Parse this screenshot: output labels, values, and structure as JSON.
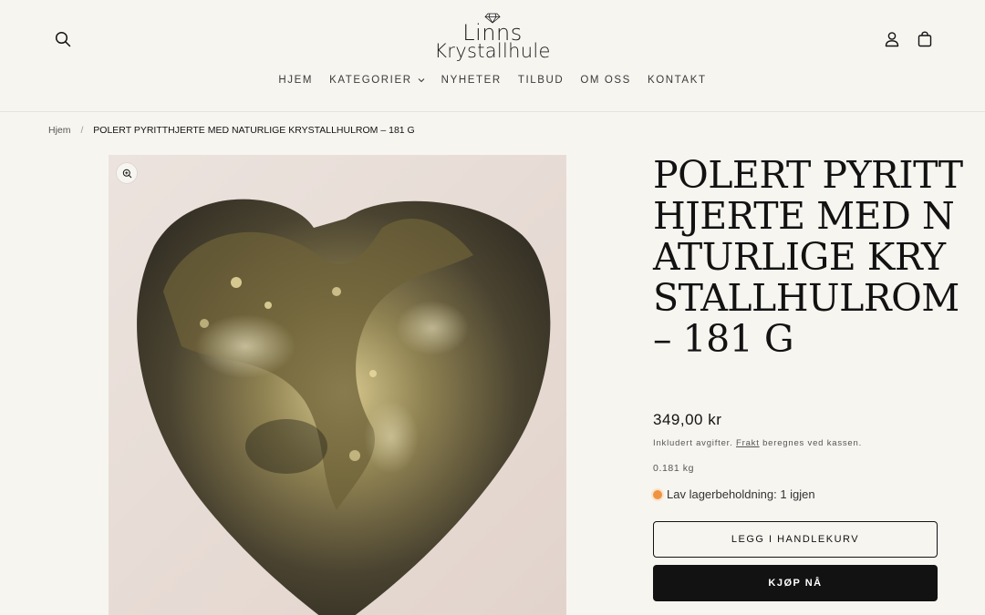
{
  "header": {
    "logo_line1": "Linns",
    "logo_line2": "Krystallhule",
    "search_icon": "search-icon",
    "account_icon": "account-icon",
    "cart_icon": "shopping-bag-icon"
  },
  "nav": {
    "items": [
      {
        "label": "HJEM"
      },
      {
        "label": "KATEGORIER",
        "has_dropdown": true
      },
      {
        "label": "NYHETER"
      },
      {
        "label": "TILBUD"
      },
      {
        "label": "OM OSS"
      },
      {
        "label": "KONTAKT"
      }
    ]
  },
  "breadcrumb": {
    "home": "Hjem",
    "separator": "/",
    "current": "POLERT PYRITTHJERTE MED NATURLIGE KRYSTALLHULROM – 181 G"
  },
  "product": {
    "title": "POLERT PYRITTHJERTE MED NATURLIGE KRYSTALLHULROM – 181 G",
    "price": "349,00 kr",
    "tax_prefix": "Inkludert avgifter.",
    "tax_link": "Frakt",
    "tax_suffix": "beregnes ved kassen.",
    "weight": "0.181 kg",
    "stock": "Lav lagerbeholdning: 1 igjen",
    "stock_color": "#ee9441",
    "add_to_cart": "LEGG I HANDLEKURV",
    "buy_now": "KJØP NÅ",
    "zoom_icon": "zoom-in-icon"
  },
  "colors": {
    "background": "#f7f5f0",
    "text": "#121212",
    "button_dark": "#121212"
  }
}
